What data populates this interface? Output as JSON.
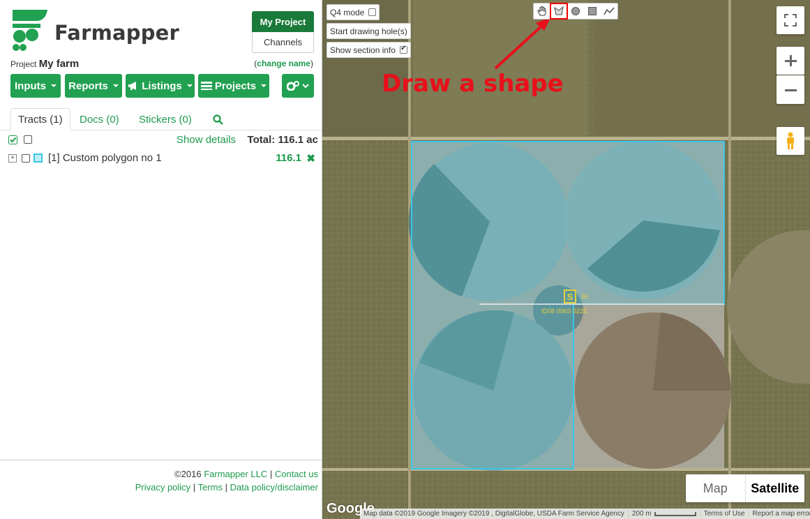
{
  "brand": {
    "name": "Farmapper"
  },
  "header": {
    "my_project_label": "My Project",
    "channels_label": "Channels",
    "project_prefix": "Project",
    "project_name": "My farm",
    "change_name_label": "change name"
  },
  "toolbar": {
    "inputs_label": "Inputs",
    "reports_label": "Reports",
    "listings_label": "Listings",
    "projects_label": "Projects"
  },
  "tabs": [
    {
      "label": "Tracts (1)"
    },
    {
      "label": "Docs (0)"
    },
    {
      "label": "Stickers (0)"
    }
  ],
  "list": {
    "show_details_label": "Show details",
    "total_label": "Total: 116.1 ac",
    "tracts": [
      {
        "name": "[1] Custom polygon no 1",
        "value": "116.1",
        "color": "#38c7e8"
      }
    ]
  },
  "footer": {
    "copyright": "©2016",
    "company_link": "Farmapper LLC",
    "contact_link": "Contact us",
    "privacy_link": "Privacy policy",
    "terms_link": "Terms",
    "data_policy_link": "Data policy/disclaimer"
  },
  "map": {
    "q4_mode_label": "Q4 mode",
    "start_hole_label": "Start drawing hole(s)",
    "section_info_label": "Show section info",
    "section_marker": "S",
    "section_number": "36",
    "section_code": "ID08 006S 022E",
    "annotation_text": "Draw a shape",
    "map_type_map": "Map",
    "map_type_satellite": "Satellite",
    "google_logo": "Google",
    "attribution": "Map data ©2019 Google Imagery ©2019 , DigitalGlobe, USDA Farm Service Agency",
    "scale_label": "200 m",
    "terms_of_use": "Terms of Use",
    "report_error": "Report a map error",
    "draw_tools": [
      "hand-icon",
      "polygon-icon",
      "circle-icon",
      "rectangle-icon",
      "polyline-icon"
    ]
  },
  "colors": {
    "brand_green": "#21a151",
    "dark_green": "#1a7a3a",
    "polygon_stroke": "#38c7e8",
    "annotation_red": "#e8101a"
  }
}
